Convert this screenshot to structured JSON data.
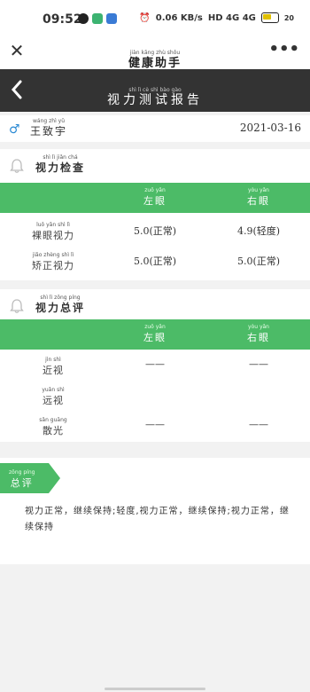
{
  "status_bar": {
    "time": "09:52",
    "speed": "0.06 KB/s",
    "network": "HD 4G 4G",
    "battery": "20"
  },
  "app_bar": {
    "title_pinyin": "jiàn kāng zhù shǒu",
    "title": "健康助手",
    "close_icon": "close-icon",
    "more_icon": "more-icon"
  },
  "page_header": {
    "title_pinyin": "shì lì cè shì bào gào",
    "title": "视力测试报告"
  },
  "user": {
    "name_pinyin": "wáng zhì yǔ",
    "name": "王致宇",
    "date": "2021-03-16",
    "gender_icon": "male-icon"
  },
  "vision_check": {
    "title_pinyin": "shì lì jiǎn chá",
    "title": "视力检查",
    "columns": [
      {
        "pinyin": "zuǒ yǎn",
        "label": "左眼"
      },
      {
        "pinyin": "yòu yǎn",
        "label": "右眼"
      }
    ],
    "rows": [
      {
        "pinyin": "luǒ yǎn shì lì",
        "label": "裸眼视力",
        "left": "5.0(正常)",
        "right": "4.9(轻度)"
      },
      {
        "pinyin": "jiǎo zhèng shì lì",
        "label": "矫正视力",
        "left": "5.0(正常)",
        "right": "5.0(正常)"
      }
    ]
  },
  "vision_review": {
    "title_pinyin": "shì lì zǒng píng",
    "title": "视力总评",
    "columns": [
      {
        "pinyin": "zuǒ yǎn",
        "label": "左眼"
      },
      {
        "pinyin": "yòu yǎn",
        "label": "右眼"
      }
    ],
    "rows": [
      {
        "pinyin": "jìn shì",
        "label": "近视",
        "left": "——",
        "right": "——"
      },
      {
        "pinyin": "yuǎn shì",
        "label": "远视",
        "left": "",
        "right": ""
      },
      {
        "pinyin": "sǎn guāng",
        "label": "散光",
        "left": "——",
        "right": "——"
      }
    ]
  },
  "summary": {
    "tag_pinyin": "zǒng píng",
    "tag": "总评",
    "text": "视力正常，继续保持;轻度,视力正常，继续保持;视力正常，继续保持"
  },
  "colors": {
    "accent": "#4cbb67",
    "header_bg": "#333333",
    "male": "#2a8ad4"
  }
}
